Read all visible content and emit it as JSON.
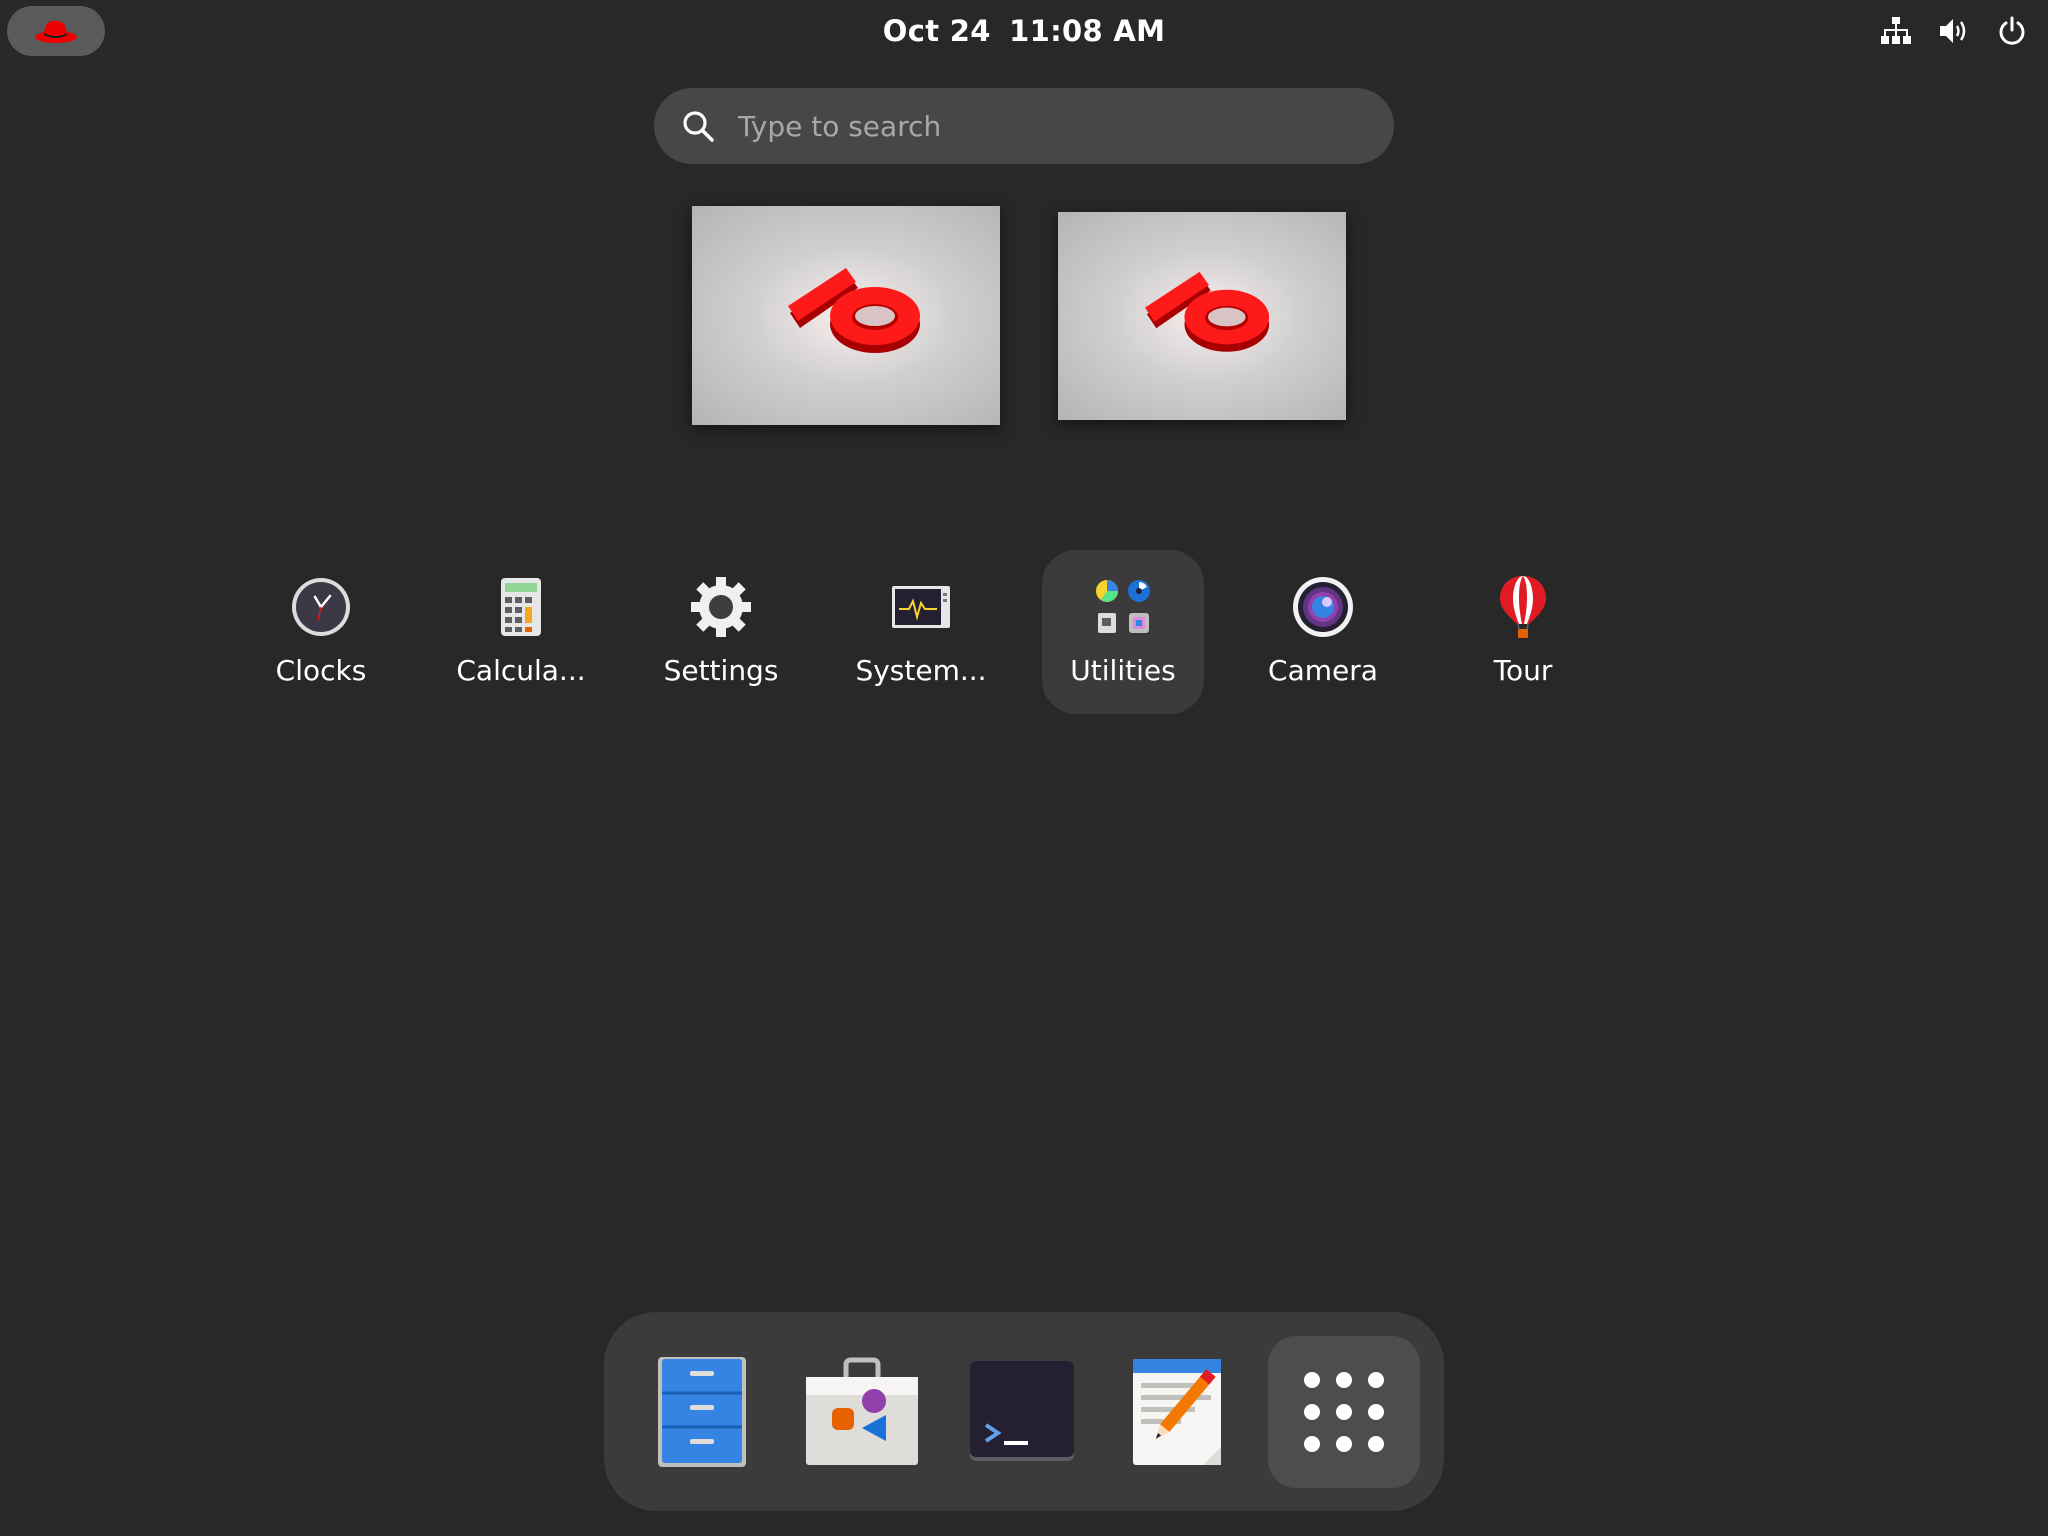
{
  "topbar": {
    "activities_icon": "redhat-hat-icon",
    "date": "Oct 24",
    "time": "11:08 AM",
    "tray_icons": [
      "network-icon",
      "volume-icon",
      "power-icon"
    ]
  },
  "search": {
    "placeholder": "Type to search",
    "icon": "search-icon"
  },
  "workspaces": [
    {
      "wallpaper": "red-10-logo"
    },
    {
      "wallpaper": "red-10-logo"
    }
  ],
  "apps": [
    {
      "label": "Clocks",
      "icon": "clock-icon"
    },
    {
      "label": "Calcula...",
      "icon": "calculator-icon"
    },
    {
      "label": "Settings",
      "icon": "gear-icon"
    },
    {
      "label": "System...",
      "icon": "system-monitor-icon"
    },
    {
      "label": "Utilities",
      "icon": "utilities-folder-icon",
      "highlighted": true
    },
    {
      "label": "Camera",
      "icon": "camera-icon"
    },
    {
      "label": "Tour",
      "icon": "balloon-icon"
    }
  ],
  "dock": [
    {
      "name": "Files",
      "icon": "file-cabinet-icon"
    },
    {
      "name": "Software",
      "icon": "shopping-bag-icon"
    },
    {
      "name": "Terminal",
      "icon": "terminal-icon"
    },
    {
      "name": "Text Editor",
      "icon": "text-editor-icon"
    },
    {
      "name": "Show Apps",
      "icon": "app-grid-icon"
    }
  ],
  "colors": {
    "background": "#282828",
    "panel": "#3b3b3b",
    "search_bg": "#474747",
    "accent_red": "#ee0000",
    "files_blue": "#3584e4"
  }
}
